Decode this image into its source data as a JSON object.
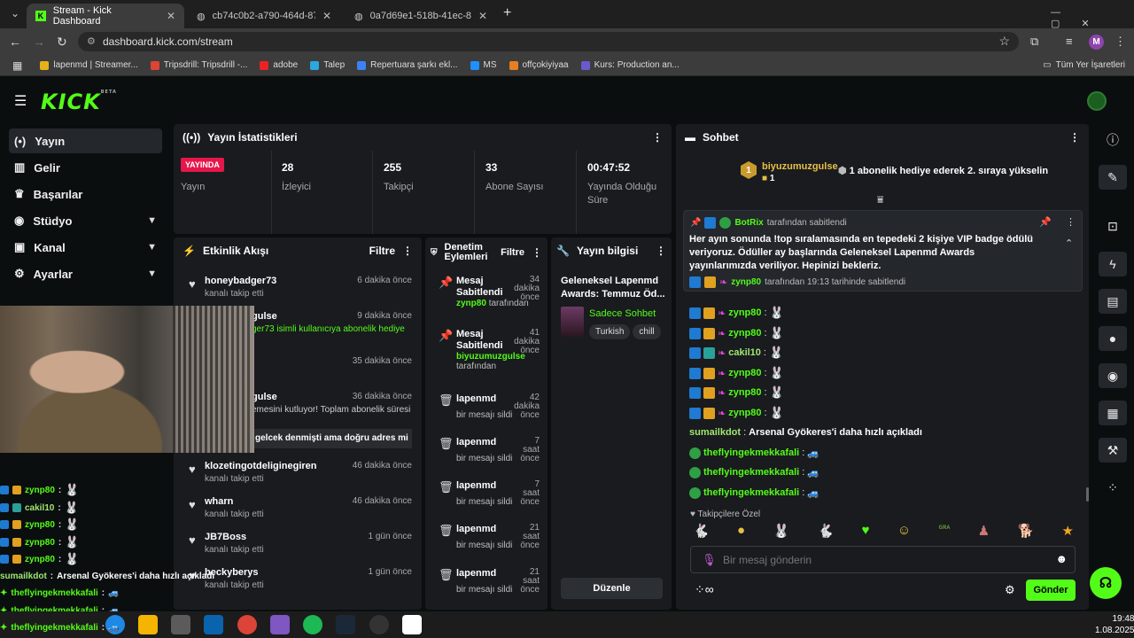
{
  "browser": {
    "tabs": [
      {
        "label": "Stream - Kick Dashboard",
        "active": true
      },
      {
        "label": "cb74c0b2-a790-464d-8758-f39",
        "active": false
      },
      {
        "label": "0a7d69e1-518b-41ec-8c07-6a",
        "active": false
      }
    ],
    "new_tab": "+",
    "url": "dashboard.kick.com/stream",
    "profile_initial": "M",
    "bookmarks": [
      "lapenmd | Streamer...",
      "Tripsdrill: Tripsdrill -...",
      "adobe",
      "Talep",
      "Repertuara şarkı ekl...",
      "MS",
      "offçokiyiyaa",
      "Kurs: Production an..."
    ],
    "bookmarks_folder": "Tüm Yer İşaretleri"
  },
  "app": {
    "logo": "KICK",
    "beta": "BETA",
    "accent": "#53fc18"
  },
  "sidebar": {
    "items": [
      {
        "label": "Yayın",
        "icon": "broadcast-icon",
        "active": true
      },
      {
        "label": "Gelir",
        "icon": "chart-icon"
      },
      {
        "label": "Başarılar",
        "icon": "trophy-icon"
      },
      {
        "label": "Stüdyo",
        "icon": "studio-icon",
        "expand": true
      },
      {
        "label": "Kanal",
        "icon": "channel-icon",
        "expand": true
      },
      {
        "label": "Ayarlar",
        "icon": "settings-icon",
        "expand": true
      }
    ]
  },
  "stats": {
    "title": "Yayın İstatistikleri",
    "live_badge": "YAYINDA",
    "live_label": "Yayın",
    "viewers": "28",
    "viewers_label": "İzleyici",
    "followers": "255",
    "followers_label": "Takipçi",
    "subs": "33",
    "subs_label": "Abone Sayısı",
    "uptime": "00:47:52",
    "uptime_label": "Yayında Olduğu Süre"
  },
  "activity": {
    "title": "Etkinlik Akışı",
    "filter": "Filtre",
    "items": [
      {
        "name": "honeybadger73",
        "sub": "kanalı takip etti",
        "time": "6 dakika önce"
      },
      {
        "name": "gulse",
        "sub": "ger73 isimli kullanıcıya abonelik hediye",
        "time": "9 dakika önce"
      },
      {
        "name": "",
        "sub": "",
        "time": "35 dakika önce"
      },
      {
        "name": "gulse",
        "sub": "emesini kutluyor! Toplam abonelik süresi",
        "time": "36 dakika önce"
      },
      {
        "name": "klozetingotdeliginegiren",
        "sub": "kanalı takip etti",
        "time": "46 dakika önce"
      },
      {
        "name": "wharn",
        "sub": "kanalı takip etti",
        "time": "46 dakika önce"
      },
      {
        "name": "JB7Boss",
        "sub": "kanalı takip etti",
        "time": "1 gün önce"
      },
      {
        "name": "beckyberys",
        "sub": "kanalı takip etti",
        "time": "1 gün önce"
      }
    ],
    "overlay_text": "gelcek denmişti ama doğru adres mi"
  },
  "moderation": {
    "title": "Denetim Eylemleri",
    "filter": "Filtre",
    "items": [
      {
        "action": "Mesaj Sabitlendi",
        "user": "zynp80",
        "by": "tarafından",
        "time": "34 dakika önce"
      },
      {
        "action": "Mesaj Sabitlendi",
        "user": "biyuzumuzgulse",
        "by": "tarafından",
        "time": "41 dakika önce"
      },
      {
        "action": "lapenmd",
        "user": "",
        "by": "bir mesajı sildi",
        "time": "42 dakika önce"
      },
      {
        "action": "lapenmd",
        "user": "",
        "by": "bir mesajı sildi",
        "time": "7 saat önce"
      },
      {
        "action": "lapenmd",
        "user": "",
        "by": "bir mesajı sildi",
        "time": "7 saat önce"
      },
      {
        "action": "lapenmd",
        "user": "",
        "by": "bir mesajı sildi",
        "time": "21 saat önce"
      },
      {
        "action": "lapenmd",
        "user": "",
        "by": "bir mesajı sildi",
        "time": "21 saat önce"
      }
    ]
  },
  "streaminfo": {
    "title": "Yayın bilgisi",
    "stream_title": "Geleneksel Lapenmd Awards: Temmuz Öd...",
    "category": "Sadece Sohbet",
    "tags": [
      "Turkish",
      "chill"
    ],
    "edit": "Düzenle"
  },
  "chat": {
    "title": "Sohbet",
    "gifter_rank": "1",
    "gifter": "biyuzumuzgulse",
    "gifter_count": "1",
    "gift_msg": "1 abonelik hediye ederek 2. sıraya yükselin",
    "pinned_by_user": "BotRix",
    "pinned_by_suffix": "tarafından sabitlendi",
    "pinned_text": "Her ayın sonunda !top sıralamasında en tepedeki 2 kişiye VIP badge ödülü veriyoruz. Ödüller ay başlarında Geleneksel Lapenmd Awards yayınlarımızda veriliyor. Hepinizi bekleriz.",
    "pinned_footer_user": "zynp80",
    "pinned_footer": "tarafından 19:13 tarihinde sabitlendi",
    "messages": [
      {
        "user": "zynp80",
        "color": "#53fc18",
        "text": ""
      },
      {
        "user": "zynp80",
        "color": "#53fc18",
        "text": ""
      },
      {
        "user": "zynp80",
        "color": "#53fc18",
        "text": ""
      },
      {
        "user": "cakil10",
        "color": "#9fe870",
        "text": ""
      },
      {
        "user": "zynp80",
        "color": "#53fc18",
        "text": ""
      },
      {
        "user": "zynp80",
        "color": "#53fc18",
        "text": ""
      },
      {
        "user": "zynp80",
        "color": "#53fc18",
        "text": ""
      },
      {
        "user": "sumailkdot",
        "color": "#9fe870",
        "text": "Arsenal Gyökeres'i daha hızlı açıkladı"
      },
      {
        "user": "theflyingekmekkafali",
        "color": "#53fc18",
        "text": ""
      },
      {
        "user": "theflyingekmekkafali",
        "color": "#53fc18",
        "text": ""
      },
      {
        "user": "theflyingekmekkafali",
        "color": "#53fc18",
        "text": ""
      }
    ],
    "emote_label": "Takipçilere Özel",
    "input_placeholder": "Bir mesaj gönderin",
    "send": "Gönder"
  },
  "overlay_chat": [
    {
      "user": "zynp80",
      "text": ""
    },
    {
      "user": "cakil10",
      "text": ""
    },
    {
      "user": "zynp80",
      "text": ""
    },
    {
      "user": "zynp80",
      "text": ""
    },
    {
      "user": "zynp80",
      "text": ""
    },
    {
      "user": "sumailkdot",
      "text": "Arsenal Gyökeres'i daha hızlı açıkladı"
    },
    {
      "user": "theflyingekmekkafali",
      "text": ""
    },
    {
      "user": "theflyingekmekkafali",
      "text": ""
    },
    {
      "user": "theflyingekmekkafali",
      "text": ""
    }
  ],
  "taskbar": {
    "time": "19:48",
    "date": "1.08.2025"
  }
}
